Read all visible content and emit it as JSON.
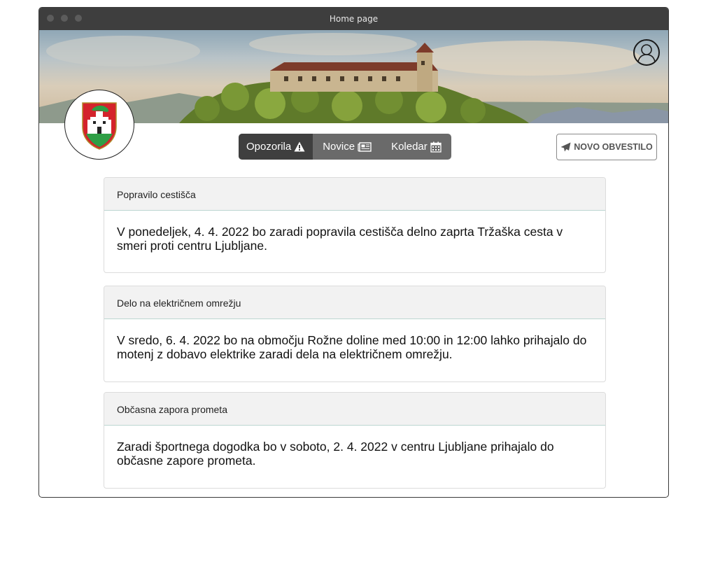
{
  "window": {
    "title": "Home page"
  },
  "header": {
    "tabs": [
      {
        "label": "Opozorila",
        "icon": "warning-icon",
        "active": true
      },
      {
        "label": "Novice",
        "icon": "newspaper-icon",
        "active": false
      },
      {
        "label": "Koledar",
        "icon": "calendar-icon",
        "active": false
      }
    ],
    "new_notice_label": "NOVO OBVESTILO",
    "profile_icon": "user-icon",
    "crest_icon": "ljubljana-crest-icon"
  },
  "notices": [
    {
      "title": "Popravilo cestišča",
      "body": "V ponedeljek, 4. 4. 2022 bo zaradi popravila cestišča delno zaprta Tržaška cesta v smeri proti centru Ljubljane."
    },
    {
      "title": "Delo na električnem omrežju",
      "body": "V sredo, 6. 4. 2022 bo na območju Rožne doline med 10:00 in 12:00 lahko prihajalo do motenj z dobavo elektrike zaradi dela na električnem omrežju."
    },
    {
      "title": "Občasna zapora prometa",
      "body": "Zaradi športnega dogodka bo v soboto, 2. 4. 2022 v centru Ljubljane prihajalo do občasne zapore prometa."
    }
  ],
  "colors": {
    "titlebar": "#3e3e3e",
    "tab_active": "#3f3f3f",
    "tab_bg": "#6a6a6a",
    "crest_red": "#d4232b",
    "crest_green": "#2e9e45"
  }
}
